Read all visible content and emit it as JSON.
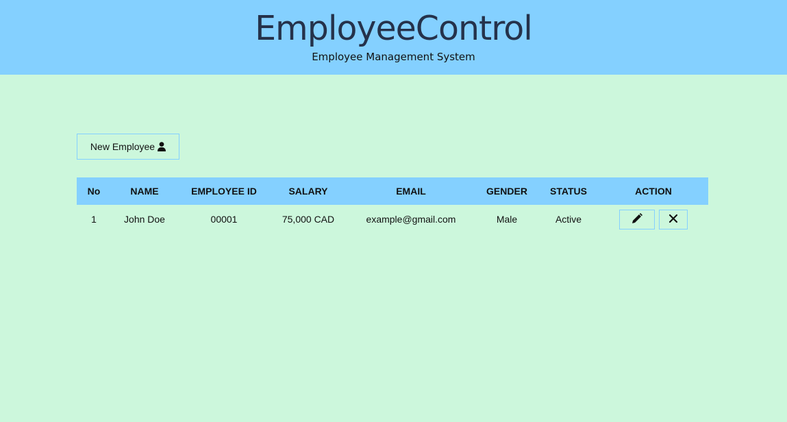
{
  "header": {
    "title": "EmployeeControl",
    "subtitle": "Employee Management System"
  },
  "toolbar": {
    "new_employee_label": "New Employee",
    "new_employee_icon": "user-icon"
  },
  "table": {
    "columns": [
      "No",
      "NAME",
      "EMPLOYEE ID",
      "SALARY",
      "EMAIL",
      "GENDER",
      "STATUS",
      "ACTION"
    ],
    "rows": [
      {
        "no": "1",
        "name": "John Doe",
        "employee_id": "00001",
        "salary": "75,000 CAD",
        "email": "example@gmail.com",
        "gender": "Male",
        "status": "Active",
        "actions": [
          "pencil-icon",
          "close-icon"
        ]
      }
    ]
  },
  "colors": {
    "header_bg": "#84d0ff",
    "page_bg": "#ccf7dc",
    "title_color": "#25324b"
  }
}
